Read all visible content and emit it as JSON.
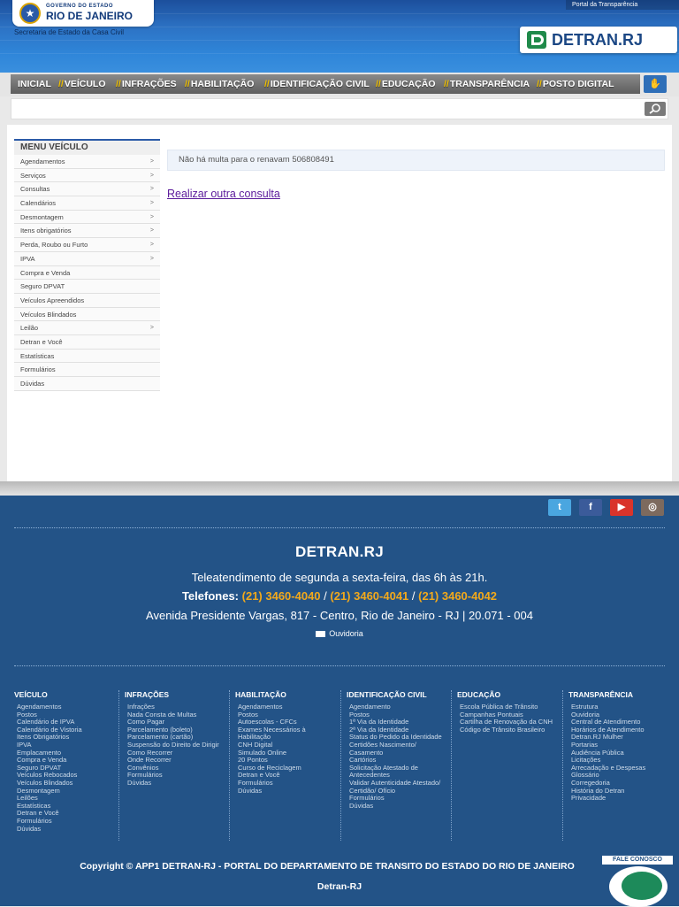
{
  "header": {
    "gov_line1": "GOVERNO DO ESTADO",
    "gov_line2": "RIO DE JANEIRO",
    "secretaria": "Secretaria de Estado da Casa Civil",
    "portal_transparencia": "Portal da Transparência",
    "detran_logo": "DETRAN.RJ"
  },
  "nav": {
    "items": [
      "INICIAL",
      "VEÍCULO",
      "INFRAÇÕES",
      "HABILITAÇÃO",
      "IDENTIFICAÇÃO CIVIL",
      "EDUCAÇÃO",
      "TRANSPARÊNCIA",
      "POSTO DIGITAL"
    ],
    "separator": "//"
  },
  "search": {
    "value": "",
    "placeholder": ""
  },
  "sidebar": {
    "title": "MENU VEÍCULO",
    "items": [
      {
        "label": "Agendamentos",
        "arrow": ">"
      },
      {
        "label": "Serviços",
        "arrow": ">"
      },
      {
        "label": "Consultas",
        "arrow": ">"
      },
      {
        "label": "Calendários",
        "arrow": ">"
      },
      {
        "label": "Desmontagem",
        "arrow": ">"
      },
      {
        "label": "Itens obrigatórios",
        "arrow": ">"
      },
      {
        "label": "Perda, Roubo ou Furto",
        "arrow": ">"
      },
      {
        "label": "IPVA",
        "arrow": ">"
      },
      {
        "label": "Compra e Venda",
        "arrow": ""
      },
      {
        "label": "Seguro DPVAT",
        "arrow": ""
      },
      {
        "label": "Veículos Apreendidos",
        "arrow": ""
      },
      {
        "label": "Veículos Blindados",
        "arrow": ""
      },
      {
        "label": "Leilão",
        "arrow": ">"
      },
      {
        "label": "Detran e Você",
        "arrow": ""
      },
      {
        "label": "Estatísticas",
        "arrow": ""
      },
      {
        "label": "Formulários",
        "arrow": ""
      },
      {
        "label": "Dúvidas",
        "arrow": ""
      }
    ]
  },
  "main": {
    "message": "Não há multa para o renavam 506808491",
    "link": "Realizar outra consulta"
  },
  "footer": {
    "brand": "DETRAN.RJ",
    "hours": "Teleatendimento de segunda a sexta-feira, das 6h às 21h.",
    "phones_label": "Telefones:",
    "phones": [
      "(21) 3460-4040",
      "(21) 3460-4041",
      "(21) 3460-4042"
    ],
    "address": "Avenida Presidente Vargas, 817 - Centro, Rio de Janeiro - RJ | 20.071 - 004",
    "ouvidoria": "Ouvidoria",
    "columns": [
      {
        "title": "VEÍCULO",
        "links": [
          "Agendamentos",
          "Postos",
          "Calendário de IPVA",
          "Calendário de Vistoria",
          "Itens Obrigatórios",
          "IPVA",
          "Emplacamento",
          "Compra e Venda",
          "Seguro DPVAT",
          "Veículos Rebocados",
          "Veículos Blindados",
          "Desmontagem",
          "Leilões",
          "Estatísticas",
          "Detran e Você",
          "Formulários",
          "Dúvidas"
        ]
      },
      {
        "title": "INFRAÇÕES",
        "links": [
          "Infrações",
          "Nada Consta de Multas",
          "Como Pagar",
          "Parcelamento (boleto)",
          "Parcelamento (cartão)",
          "Suspensão do Direito de Dirigir",
          "Como Recorrer",
          "Onde Recorrer",
          "Convênios",
          "Formulários",
          "Dúvidas"
        ]
      },
      {
        "title": "HABILITAÇÃO",
        "links": [
          "Agendamentos",
          "Postos",
          "Autoescolas - CFCs",
          "Exames Necessários à Habilitação",
          "CNH Digital",
          "Simulado Online",
          "20 Pontos",
          "Curso de Reciclagem",
          "Detran e Você",
          "Formulários",
          "Dúvidas"
        ]
      },
      {
        "title": "IDENTIFICAÇÃO CIVIL",
        "links": [
          "Agendamento",
          "Postos",
          "1ª Via da Identidade",
          "2ª Via da Identidade",
          "Status do Pedido da Identidade",
          "Certidões Nascimento/ Casamento",
          "Cartórios",
          "Solicitação Atestado de Antecedentes",
          "Validar Autenticidade Atestado/ Certidão/ Ofício",
          "Formulários",
          "Dúvidas"
        ]
      },
      {
        "title": "EDUCAÇÃO",
        "links": [
          "Escola Pública de Trânsito",
          "Campanhas Pontuais",
          "Cartilha de Renovação da CNH",
          "Código de Trânsito Brasileiro"
        ]
      },
      {
        "title": "TRANSPARÊNCIA",
        "links": [
          "Estrutura",
          "Ouvidoria",
          "Central de Atendimento",
          "Horários de Atendimento",
          "Detran.RJ Mulher",
          "Portarias",
          "Audiência Pública",
          "Licitações",
          "Arrecadação e Despesas",
          "Glossário",
          "Corregedoria",
          "História do Detran",
          "Privacidade"
        ]
      }
    ],
    "copyright": "Copyright © APP1 DETRAN-RJ - PORTAL DO DEPARTAMENTO DE TRANSITO DO ESTADO DO RIO DE JANEIRO",
    "copyright2": "Detran-RJ",
    "fale_conosco": "FALE CONOSCO"
  },
  "colors": {
    "header_blue": "#2d74c6",
    "footer_blue": "#235387",
    "phone_orange": "#f2a91b",
    "nav_slash": "#f0c000"
  }
}
